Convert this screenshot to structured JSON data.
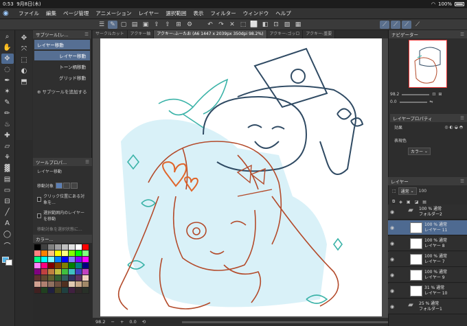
{
  "status": {
    "time": "0:53",
    "date": "9月8日(木)",
    "battery": "100%"
  },
  "menu": [
    "ファイル",
    "編集",
    "ページ管理",
    "アニメーション",
    "レイヤー",
    "選択範囲",
    "表示",
    "フィルター",
    "ウィンドウ",
    "ヘルプ"
  ],
  "sub_tool_panel": {
    "title": "サブツール[レ...",
    "items": [
      "レイヤー移動",
      "レイヤー移動",
      "トーン柄移動",
      "グリッド移動"
    ],
    "add_label": "サブツールを追加する"
  },
  "tool_property": {
    "title": "ツールプロパ...",
    "tool_name": "レイヤー移動",
    "target_label": "移動対象",
    "options": [
      "クリック位置にある対象を...",
      "選択範囲内のレイヤーを移動"
    ],
    "extra": "移動対象を選択状態に..."
  },
  "color_panel": {
    "title": "カラー..."
  },
  "tabs": [
    "サークルカット",
    "アクキー軸",
    "アクキー-ふーたお (A6 1447 x 2039px 350dpi 98.2%)",
    "アクキー-ゴッロ",
    "アクキー-重要"
  ],
  "canvas_zoom": "98.2",
  "canvas_angle": "0.0",
  "navigator": {
    "title": "ナビゲーター",
    "zoom": "98.2",
    "angle": "0.0"
  },
  "layer_property": {
    "title": "レイヤープロパティ",
    "effect_label": "効果",
    "expression_label": "表現色",
    "expression_value": "カラー"
  },
  "layer_panel": {
    "title": "レイヤー",
    "blend_mode": "通常",
    "opacity": "100",
    "layers": [
      {
        "line1": "100 %  通常",
        "line2": "フォルダー2",
        "type": "folder"
      },
      {
        "line1": "100 %  通常",
        "line2": "レイヤー 11",
        "type": "layer",
        "selected": true
      },
      {
        "line1": "100 %  通常",
        "line2": "レイヤー 8",
        "type": "layer"
      },
      {
        "line1": "100 %  通常",
        "line2": "レイヤー 7",
        "type": "layer"
      },
      {
        "line1": "100 %  通常",
        "line2": "レイヤー 9",
        "type": "layer"
      },
      {
        "line1": "31 %  通常",
        "line2": "レイヤー 10",
        "type": "layer"
      },
      {
        "line1": "25 %  通常",
        "line2": "フォルダー1",
        "type": "folder"
      }
    ]
  },
  "palette": [
    "#000000",
    "#404040",
    "#808080",
    "#a0a0a0",
    "#c0c0c0",
    "#e0e0e0",
    "#ffffff",
    "#ff0000",
    "#ff8080",
    "#ff8000",
    "#ffc080",
    "#ffff00",
    "#ffff80",
    "#80ff00",
    "#00ff00",
    "#80ff80",
    "#00ff80",
    "#00ffff",
    "#80ffff",
    "#0080ff",
    "#0000ff",
    "#8080ff",
    "#8000ff",
    "#ff00ff",
    "#ff80ff",
    "#ff0080",
    "#800000",
    "#804000",
    "#808000",
    "#008000",
    "#008080",
    "#000080",
    "#800080",
    "#c04040",
    "#c08040",
    "#c0c040",
    "#40c040",
    "#40c0c0",
    "#4040c0",
    "#c040c0",
    "#603030",
    "#604830",
    "#606030",
    "#306030",
    "#306060",
    "#303060",
    "#603060",
    "#f0d0c0",
    "#d0a090",
    "#b08070",
    "#907060",
    "#705040",
    "#503020",
    "#e0c8b0",
    "#c8a888",
    "#a08868",
    "#402020",
    "#204020",
    "#202040",
    "#404020",
    "#204040",
    "#402040",
    "#302828",
    "#283028"
  ]
}
